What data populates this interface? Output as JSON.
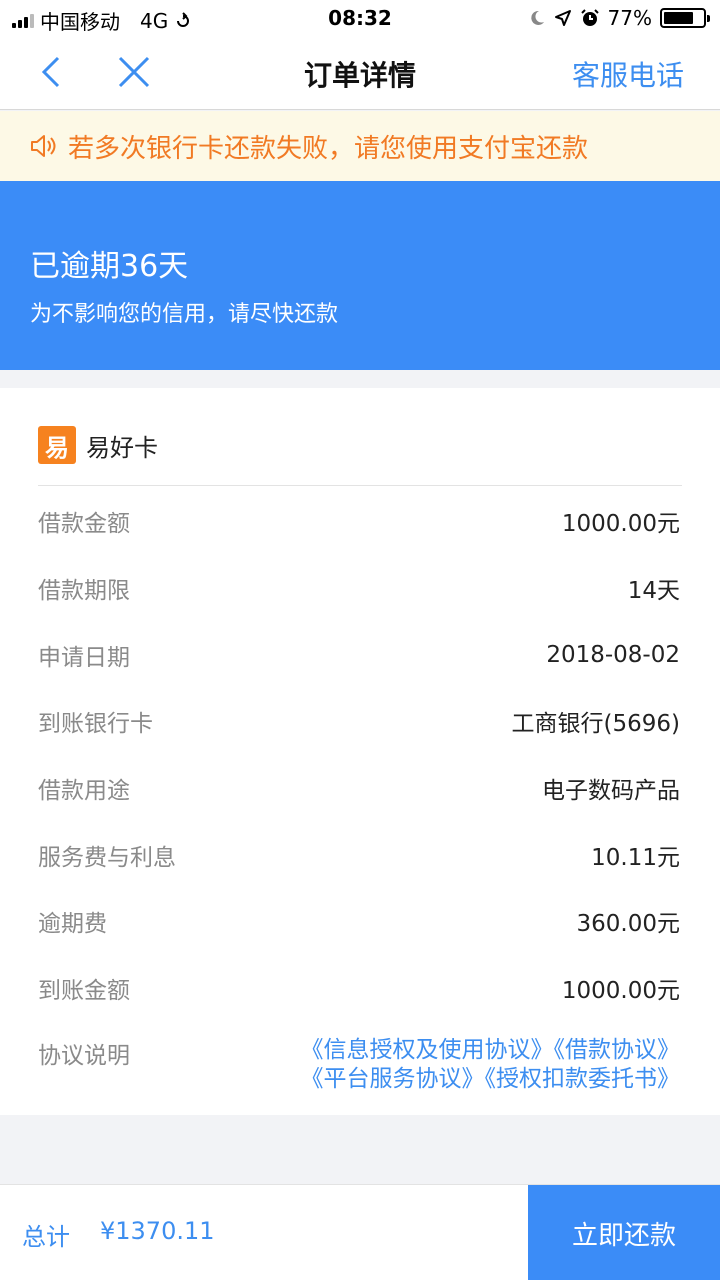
{
  "status_bar": {
    "carrier": "中国移动",
    "network": "4G",
    "time": "08:32",
    "battery": "77%",
    "battery_level": 0.77
  },
  "nav": {
    "title": "订单详情",
    "service": "客服电话"
  },
  "notice": {
    "text": "若多次银行卡还款失败，请您使用支付宝还款"
  },
  "banner": {
    "status": "已逾期36天",
    "subtitle": "为不影响您的信用，请尽快还款"
  },
  "card": {
    "brand_logo": "易",
    "brand_name": "易好卡",
    "rows": [
      {
        "label": "借款金额",
        "value": "1000.00元"
      },
      {
        "label": "借款期限",
        "value": "14天"
      },
      {
        "label": "申请日期",
        "value": "2018-08-02"
      },
      {
        "label": "到账银行卡",
        "value": "工商银行(5696)"
      },
      {
        "label": "借款用途",
        "value": "电子数码产品"
      },
      {
        "label": "服务费与利息",
        "value": "10.11元"
      },
      {
        "label": "逾期费",
        "value": "360.00元"
      },
      {
        "label": "到账金额",
        "value": "1000.00元"
      }
    ],
    "agreement": {
      "label": "协议说明",
      "links": [
        "《信息授权及使用协议》",
        "《借款协议》",
        "《平台服务协议》",
        "《授权扣款委托书》"
      ]
    }
  },
  "bottom": {
    "total_label": "总计",
    "total_amount": "¥1370.11",
    "pay_button": "立即还款"
  },
  "colors": {
    "accent": "#3b8cf7",
    "link": "#3d8ef0",
    "notice_text": "#f17a24",
    "notice_bg": "#fdf9e6",
    "brand": "#f6821f"
  }
}
